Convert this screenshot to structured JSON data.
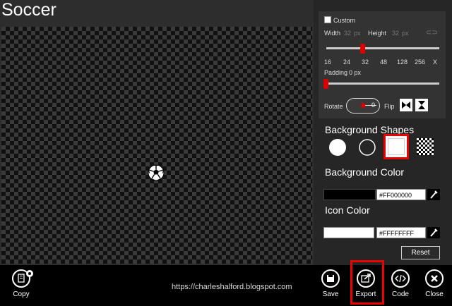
{
  "app": {
    "title": "Soccer"
  },
  "size_panel": {
    "custom_label": "Custom",
    "width_label": "Width",
    "width_value": "32",
    "height_label": "Height",
    "height_value": "32",
    "unit": "px",
    "size_ticks": [
      "16",
      "24",
      "32",
      "48",
      "128",
      "256",
      "X"
    ],
    "padding_label": "Padding",
    "padding_value": "0 px",
    "rotate_label": "Rotate",
    "rotate_value": "0",
    "flip_label": "Flip"
  },
  "background_shapes": {
    "heading": "Background Shapes"
  },
  "background_color": {
    "heading": "Background Color",
    "hex": "#FF000000"
  },
  "icon_color": {
    "heading": "Icon Color",
    "hex": "#FFFFFFFF"
  },
  "reset_label": "Reset",
  "appbar": {
    "copy_label": "Copy",
    "url": "https://charleshalford.blogspot.com",
    "save_label": "Save",
    "export_label": "Export",
    "code_label": "Code",
    "close_label": "Close"
  },
  "colors": {
    "accent": "#e00000",
    "panel": "#262626",
    "appbar": "#000000"
  }
}
